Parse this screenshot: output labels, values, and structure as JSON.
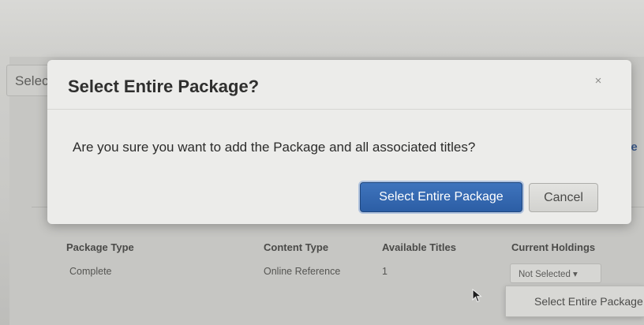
{
  "background": {
    "select_field_text": "Selec",
    "right_link_text": "ate",
    "table": {
      "headers": [
        "Package Type",
        "Content Type",
        "Available Titles",
        "Current Holdings"
      ],
      "row": {
        "package_type": "Complete",
        "content_type": "Online Reference",
        "available_titles": "1",
        "current_holdings": "Not Selected ▾"
      }
    },
    "dropdown_menu_item": "Select Entire Package"
  },
  "modal": {
    "title": "Select Entire Package?",
    "close_glyph": "×",
    "message": "Are you sure you want to add the Package and all associated titles?",
    "confirm_label": "Select Entire Package",
    "cancel_label": "Cancel"
  },
  "colors": {
    "primary_button": "#2c5ea5",
    "link": "#3c5a8a"
  },
  "icons": {
    "cursor": "mouse-pointer-icon",
    "close": "close-icon",
    "caret": "caret-down-icon"
  }
}
